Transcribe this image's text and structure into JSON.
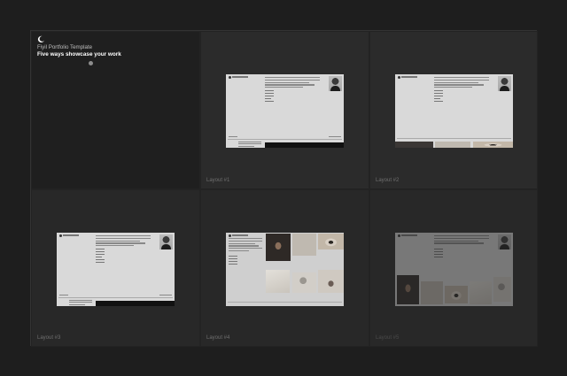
{
  "intro": {
    "icon": "moon-icon",
    "title": "Fiyil Portfolio Template",
    "subtitle": "Five ways showcase your work"
  },
  "layouts": [
    {
      "label": "Layout #1"
    },
    {
      "label": "Layout #2"
    },
    {
      "label": "Layout #3"
    },
    {
      "label": "Layout #4"
    },
    {
      "label": "Layout #5"
    }
  ],
  "colors": {
    "background": "#1e1e1e",
    "cell": "#2b2b2b",
    "thumb": "#d9d9d9",
    "text_primary": "#ffffff",
    "text_muted": "#707070"
  }
}
